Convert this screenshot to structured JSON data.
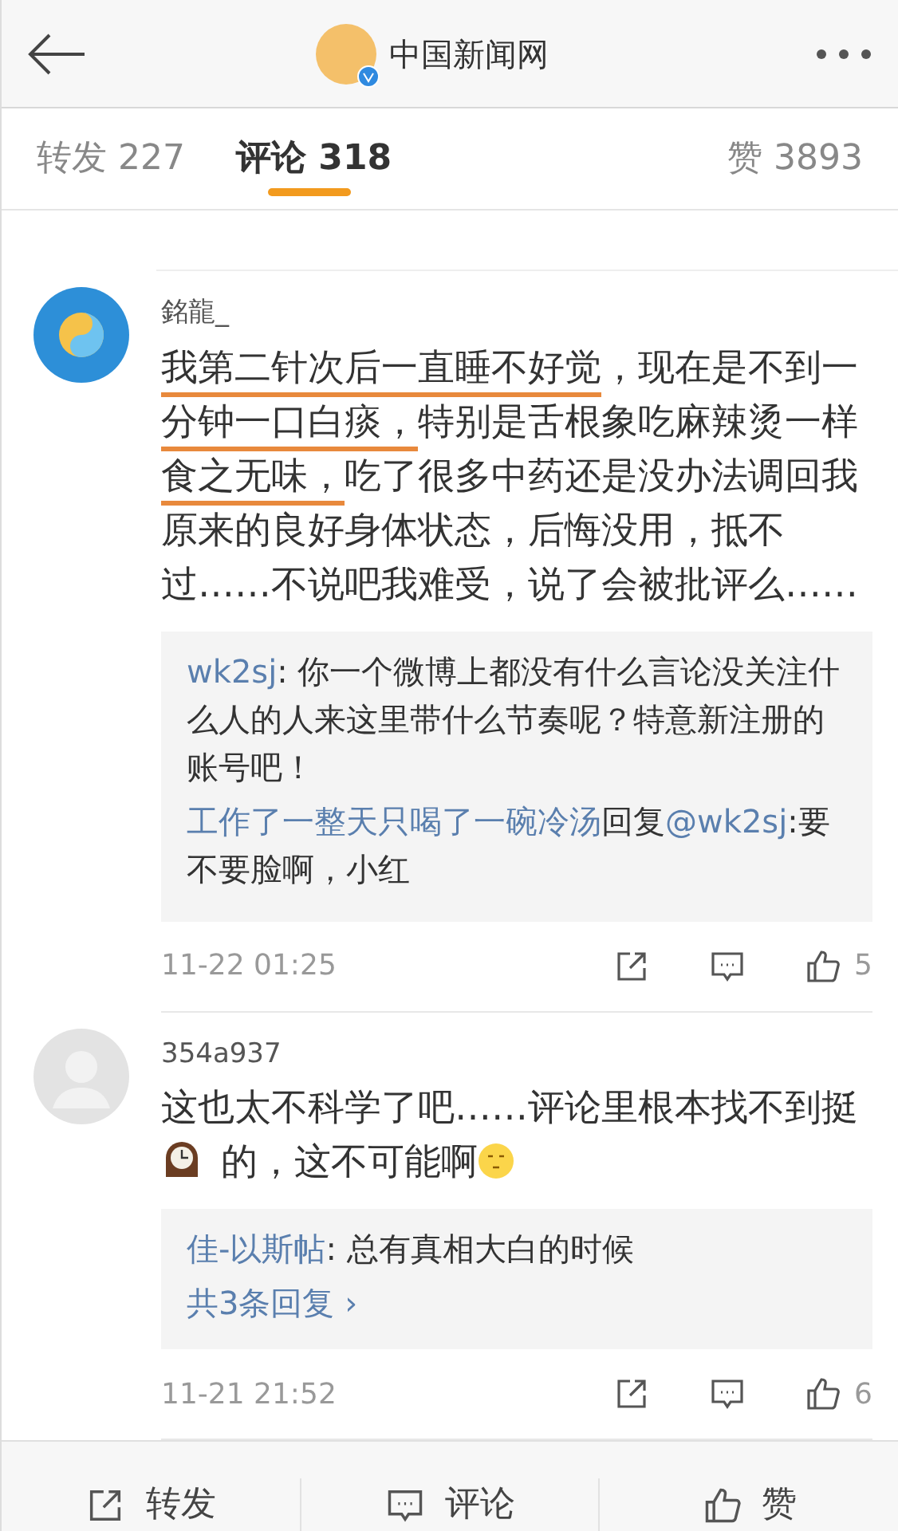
{
  "header": {
    "title": "中国新闻网",
    "verified": true
  },
  "tabs": [
    {
      "label": "转发 227",
      "selected": false
    },
    {
      "label": "评论 318",
      "selected": true
    },
    {
      "label": "赞 3893",
      "selected": false
    }
  ],
  "comments": [
    {
      "kind": "custom",
      "user": "銘龍_",
      "body": [
        {
          "kind": "text",
          "text": "我第二针次后一直睡不好觉",
          "marked": true
        },
        {
          "kind": "text",
          "text": "，现在是不到一",
          "marked": false
        },
        {
          "kind": "text",
          "text": "分钟一口白痰，",
          "marked": true
        },
        {
          "kind": "text",
          "text": "特别是舌根象吃麻辣烫一样",
          "marked": false
        },
        {
          "kind": "text",
          "text": "食之无味，",
          "marked": true
        },
        {
          "kind": "text",
          "text": "吃了很多中药还是没办法调回我原来的良好身体状态，后悔没用，抵不过……不说吧我难受，说了会被批评么……",
          "marked": false
        }
      ],
      "replies": [
        {
          "parts": [
            {
              "kind": "user",
              "text": "wk2sj"
            },
            {
              "kind": "text",
              "text": ": 你一个微博上都没有什么言论没关注什么人的人来这里带什么节奏呢？特意新注册的账号吧！"
            }
          ]
        },
        {
          "parts": [
            {
              "kind": "user",
              "text": "工作了一整天只喝了一碗冷汤"
            },
            {
              "kind": "text",
              "text": "回复"
            },
            {
              "kind": "user",
              "text": "@wk2sj"
            },
            {
              "kind": "text",
              "text": ":要不要脸啊，小红"
            }
          ]
        }
      ],
      "time": "11-22 01:25",
      "likes": "5"
    },
    {
      "kind": "default",
      "user": "354a937",
      "body": [
        {
          "kind": "text",
          "text": "这也太不科学了吧……评论里根本找不到挺",
          "marked": false
        },
        {
          "kind": "clock"
        },
        {
          "kind": "text",
          "text": " 的，这不可能啊",
          "marked": false
        },
        {
          "kind": "face"
        }
      ],
      "replies": [
        {
          "parts": [
            {
              "kind": "user",
              "text": "佳-以斯帖"
            },
            {
              "kind": "text",
              "text": ": 总有真相大白的时候"
            }
          ]
        }
      ],
      "more": "共3条回复 ›",
      "time": "11-21 21:52",
      "likes": "6"
    }
  ],
  "actions": [
    {
      "kind": "repost",
      "label": "转发"
    },
    {
      "kind": "comment",
      "label": "评论"
    },
    {
      "kind": "like",
      "label": "赞"
    }
  ]
}
